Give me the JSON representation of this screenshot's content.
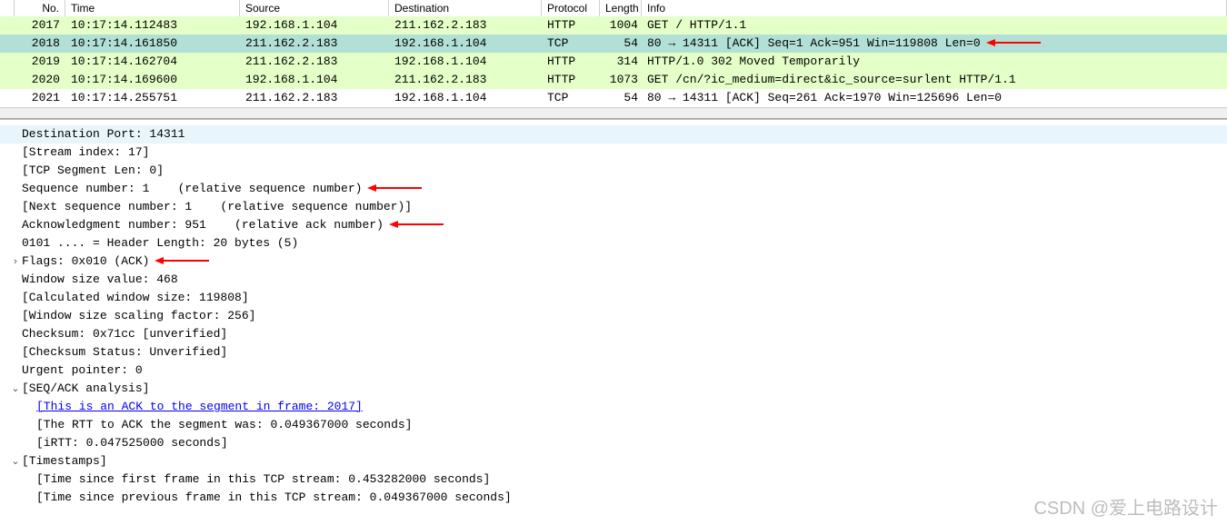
{
  "headers": {
    "no": "No.",
    "time": "Time",
    "source": "Source",
    "destination": "Destination",
    "protocol": "Protocol",
    "length": "Length",
    "info": "Info"
  },
  "packets": [
    {
      "no": "2017",
      "time": "10:17:14.112483",
      "src": "192.168.1.104",
      "dst": "211.162.2.183",
      "proto": "HTTP",
      "len": "1004",
      "info": "GET / HTTP/1.1",
      "cls": "green",
      "arrow": false
    },
    {
      "no": "2018",
      "time": "10:17:14.161850",
      "src": "211.162.2.183",
      "dst": "192.168.1.104",
      "proto": "TCP",
      "len": "54",
      "info": "80 → 14311 [ACK] Seq=1 Ack=951 Win=119808 Len=0",
      "cls": "selected",
      "arrow": true
    },
    {
      "no": "2019",
      "time": "10:17:14.162704",
      "src": "211.162.2.183",
      "dst": "192.168.1.104",
      "proto": "HTTP",
      "len": "314",
      "info": "HTTP/1.0 302 Moved Temporarily",
      "cls": "green",
      "arrow": false
    },
    {
      "no": "2020",
      "time": "10:17:14.169600",
      "src": "192.168.1.104",
      "dst": "211.162.2.183",
      "proto": "HTTP",
      "len": "1073",
      "info": "GET /cn/?ic_medium=direct&ic_source=surlent HTTP/1.1",
      "cls": "green",
      "arrow": false
    },
    {
      "no": "2021",
      "time": "10:17:14.255751",
      "src": "211.162.2.183",
      "dst": "192.168.1.104",
      "proto": "TCP",
      "len": "54",
      "info": "80 → 14311 [ACK] Seq=261 Ack=1970 Win=125696 Len=0",
      "cls": "",
      "arrow": false
    }
  ],
  "details": [
    {
      "exp": "",
      "indent": 1,
      "text": "Destination Port: 14311",
      "hl": true,
      "arrow": false
    },
    {
      "exp": "",
      "indent": 1,
      "text": "[Stream index: 17]",
      "hl": false,
      "arrow": false
    },
    {
      "exp": "",
      "indent": 1,
      "text": "[TCP Segment Len: 0]",
      "hl": false,
      "arrow": false
    },
    {
      "exp": "",
      "indent": 1,
      "text": "Sequence number: 1    (relative sequence number)",
      "hl": false,
      "arrow": true
    },
    {
      "exp": "",
      "indent": 1,
      "text": "[Next sequence number: 1    (relative sequence number)]",
      "hl": false,
      "arrow": false
    },
    {
      "exp": "",
      "indent": 1,
      "text": "Acknowledgment number: 951    (relative ack number)",
      "hl": false,
      "arrow": true
    },
    {
      "exp": "",
      "indent": 1,
      "text": "0101 .... = Header Length: 20 bytes (5)",
      "hl": false,
      "arrow": false
    },
    {
      "exp": ">",
      "indent": 1,
      "text": "Flags: 0x010 (ACK)",
      "hl": false,
      "arrow": true
    },
    {
      "exp": "",
      "indent": 1,
      "text": "Window size value: 468",
      "hl": false,
      "arrow": false
    },
    {
      "exp": "",
      "indent": 1,
      "text": "[Calculated window size: 119808]",
      "hl": false,
      "arrow": false
    },
    {
      "exp": "",
      "indent": 1,
      "text": "[Window size scaling factor: 256]",
      "hl": false,
      "arrow": false
    },
    {
      "exp": "",
      "indent": 1,
      "text": "Checksum: 0x71cc [unverified]",
      "hl": false,
      "arrow": false
    },
    {
      "exp": "",
      "indent": 1,
      "text": "[Checksum Status: Unverified]",
      "hl": false,
      "arrow": false
    },
    {
      "exp": "",
      "indent": 1,
      "text": "Urgent pointer: 0",
      "hl": false,
      "arrow": false
    },
    {
      "exp": "v",
      "indent": 1,
      "text": "[SEQ/ACK analysis]",
      "hl": false,
      "arrow": false
    },
    {
      "exp": "",
      "indent": 2,
      "text": "[This is an ACK to the segment in frame: 2017]",
      "hl": false,
      "arrow": false,
      "link": true
    },
    {
      "exp": "",
      "indent": 2,
      "text": "[The RTT to ACK the segment was: 0.049367000 seconds]",
      "hl": false,
      "arrow": false
    },
    {
      "exp": "",
      "indent": 2,
      "text": "[iRTT: 0.047525000 seconds]",
      "hl": false,
      "arrow": false
    },
    {
      "exp": "v",
      "indent": 1,
      "text": "[Timestamps]",
      "hl": false,
      "arrow": false
    },
    {
      "exp": "",
      "indent": 2,
      "text": "[Time since first frame in this TCP stream: 0.453282000 seconds]",
      "hl": false,
      "arrow": false
    },
    {
      "exp": "",
      "indent": 2,
      "text": "[Time since previous frame in this TCP stream: 0.049367000 seconds]",
      "hl": false,
      "arrow": false
    }
  ],
  "watermark": "CSDN @爱上电路设计"
}
